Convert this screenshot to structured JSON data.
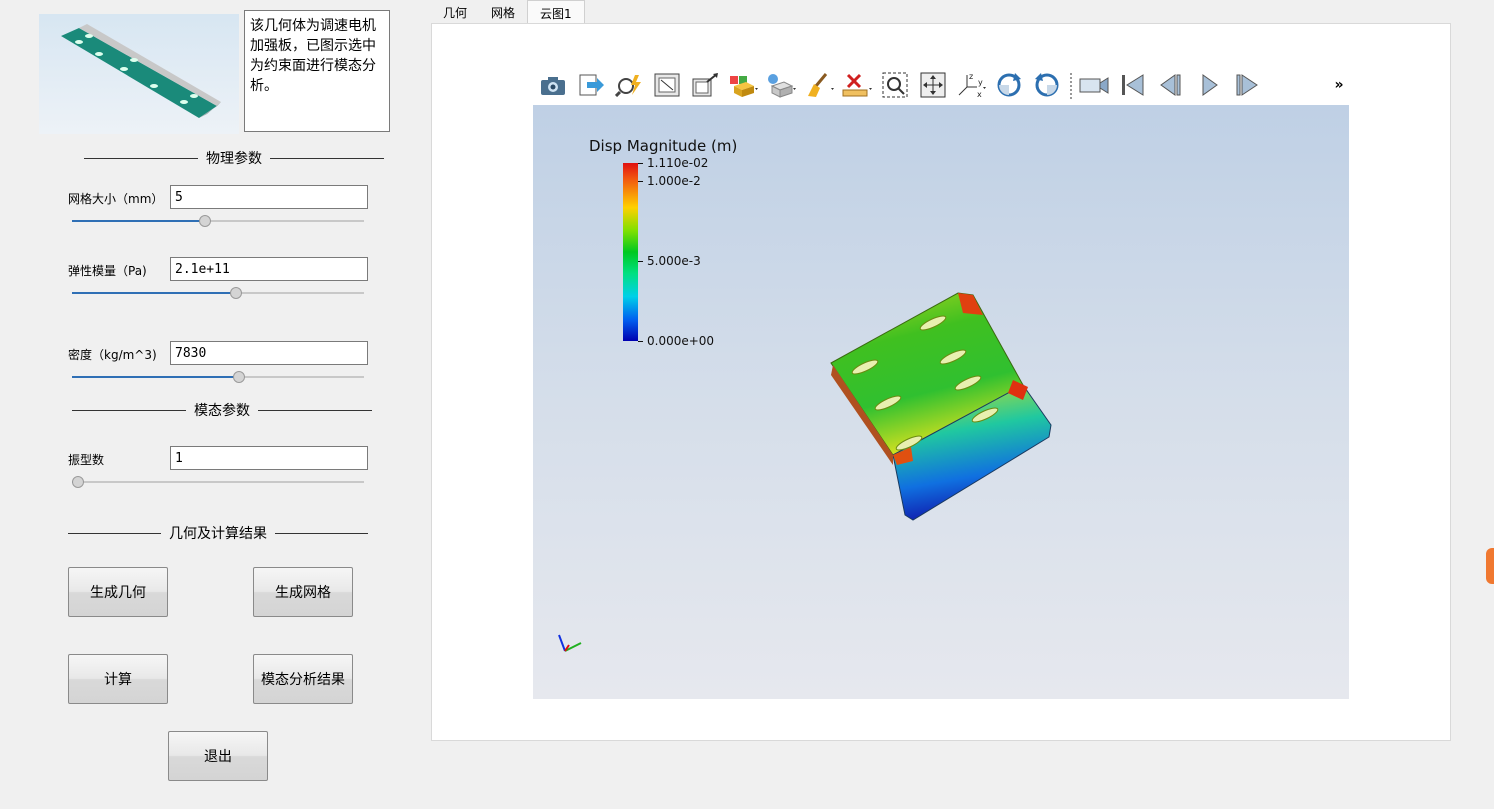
{
  "description_text": "该几何体为调速电机加强板，已图示选中为约束面进行模态分析。",
  "physical_params": {
    "section_title": "物理参数",
    "mesh_size": {
      "label": "网格大小（mm）",
      "value": "5",
      "slider_fraction": 0.45
    },
    "elastic_modulus": {
      "label": "弹性模量（Pa)",
      "value": "2.1e+11",
      "slider_fraction": 0.56
    },
    "density": {
      "label": "密度（kg/m^3)",
      "value": "7830",
      "slider_fraction": 0.57
    }
  },
  "modal_params": {
    "section_title": "模态参数",
    "mode_count": {
      "label": "振型数",
      "value": "1",
      "slider_fraction": 0.0
    }
  },
  "results": {
    "section_title": "几何及计算结果",
    "buttons": {
      "generate_geometry": "生成几何",
      "generate_mesh": "生成网格",
      "compute": "计算",
      "modal_results": "模态分析结果",
      "exit": "退出"
    }
  },
  "tabs": [
    {
      "label": "几何"
    },
    {
      "label": "网格"
    },
    {
      "label": "云图1",
      "active": true
    }
  ],
  "viewer": {
    "toolbar_icons": [
      "camera-icon",
      "export-icon",
      "pick-icon",
      "zoom-fit-icon",
      "reset-view-icon",
      "display-mode-icon",
      "view-options-icon",
      "clear-brush-icon",
      "delete-measure-icon",
      "zoom-box-icon",
      "pan-icon",
      "axis-orientation-icon",
      "rotate-cw-icon",
      "rotate-ccw-icon",
      "record-icon",
      "first-frame-icon",
      "prev-frame-icon",
      "play-icon",
      "next-frame-icon",
      "more-icon"
    ],
    "overflow_label": "»",
    "legend": {
      "title": "Disp Magnitude (m)",
      "ticks": [
        "1.110e-02",
        "1.000e-2",
        "5.000e-3",
        "0.000e+00"
      ],
      "max": 0.0111,
      "min": 0.0
    },
    "colors": {
      "background_top": "#bfd0e5",
      "background_bottom": "#e6e8ee"
    }
  }
}
